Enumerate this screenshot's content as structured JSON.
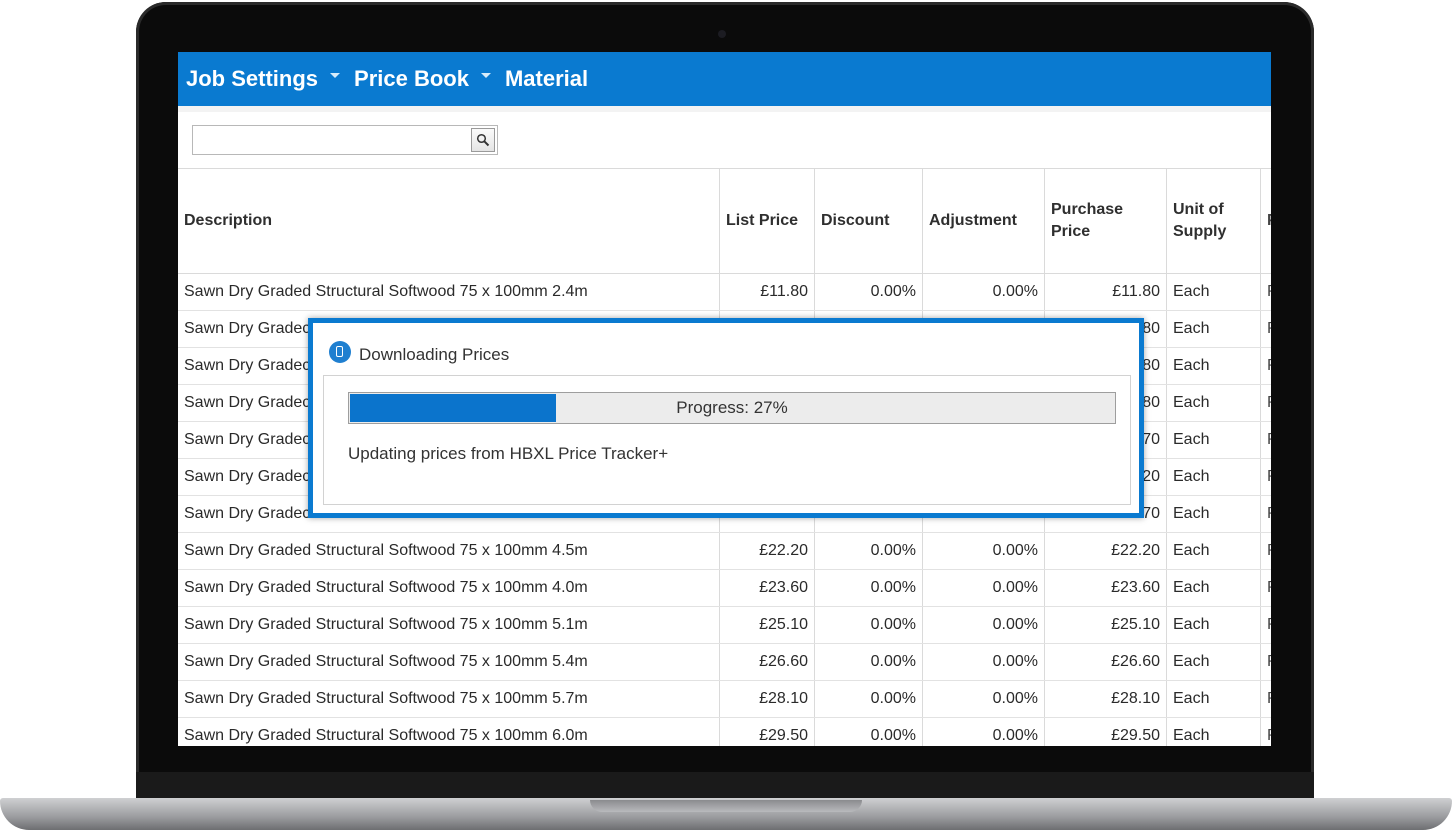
{
  "nav": {
    "items": [
      {
        "label": "Job Settings",
        "dropdown": true
      },
      {
        "label": "Price Book",
        "dropdown": true
      },
      {
        "label": "Material",
        "dropdown": false
      }
    ]
  },
  "search": {
    "value": "",
    "placeholder": "",
    "icon": "search-icon"
  },
  "table": {
    "headers": {
      "description": "Description",
      "list_price": "List Price",
      "discount": "Discount",
      "adjustment": "Adjustment",
      "purchase_price": "Purchase Price",
      "unit_of_supply": "Unit of Supply",
      "truncated": "P"
    },
    "rows": [
      {
        "description": "Sawn Dry Graded Structural Softwood 75 x 100mm 2.4m",
        "list_price": "£11.80",
        "discount": "0.00%",
        "adjustment": "0.00%",
        "purchase_price": "£11.80",
        "unit": "Each",
        "truncated": "P"
      },
      {
        "description": "Sawn Dry Gradec",
        "list_price": "",
        "discount": "",
        "adjustment": "",
        "purchase_price": "80",
        "unit": "Each",
        "truncated": "P"
      },
      {
        "description": "Sawn Dry Gradec",
        "list_price": "",
        "discount": "",
        "adjustment": "",
        "purchase_price": "80",
        "unit": "Each",
        "truncated": "P"
      },
      {
        "description": "Sawn Dry Gradec",
        "list_price": "",
        "discount": "",
        "adjustment": "",
        "purchase_price": "80",
        "unit": "Each",
        "truncated": "P"
      },
      {
        "description": "Sawn Dry Gradec",
        "list_price": "",
        "discount": "",
        "adjustment": "",
        "purchase_price": "70",
        "unit": "Each",
        "truncated": "P"
      },
      {
        "description": "Sawn Dry Gradec",
        "list_price": "",
        "discount": "",
        "adjustment": "",
        "purchase_price": "20",
        "unit": "Each",
        "truncated": "P"
      },
      {
        "description": "Sawn Dry Gradec",
        "list_price": "",
        "discount": "",
        "adjustment": "",
        "purchase_price": "70",
        "unit": "Each",
        "truncated": "P"
      },
      {
        "description": "Sawn Dry Graded Structural Softwood 75 x 100mm 4.5m",
        "list_price": "£22.20",
        "discount": "0.00%",
        "adjustment": "0.00%",
        "purchase_price": "£22.20",
        "unit": "Each",
        "truncated": "P"
      },
      {
        "description": "Sawn Dry Graded Structural Softwood 75 x 100mm 4.0m",
        "list_price": "£23.60",
        "discount": "0.00%",
        "adjustment": "0.00%",
        "purchase_price": "£23.60",
        "unit": "Each",
        "truncated": "P"
      },
      {
        "description": "Sawn Dry Graded Structural Softwood 75 x 100mm 5.1m",
        "list_price": "£25.10",
        "discount": "0.00%",
        "adjustment": "0.00%",
        "purchase_price": "£25.10",
        "unit": "Each",
        "truncated": "P"
      },
      {
        "description": "Sawn Dry Graded Structural Softwood 75 x 100mm 5.4m",
        "list_price": "£26.60",
        "discount": "0.00%",
        "adjustment": "0.00%",
        "purchase_price": "£26.60",
        "unit": "Each",
        "truncated": "P"
      },
      {
        "description": "Sawn Dry Graded Structural Softwood 75 x 100mm 5.7m",
        "list_price": "£28.10",
        "discount": "0.00%",
        "adjustment": "0.00%",
        "purchase_price": "£28.10",
        "unit": "Each",
        "truncated": "P"
      },
      {
        "description": "Sawn Dry Graded Structural Softwood 75 x 100mm 6.0m",
        "list_price": "£29.50",
        "discount": "0.00%",
        "adjustment": "0.00%",
        "purchase_price": "£29.50",
        "unit": "Each",
        "truncated": "P"
      }
    ]
  },
  "dialog": {
    "title": "Downloading Prices",
    "icon": "download-info-icon",
    "progress_percent": 27,
    "progress_label": "Progress: 27%",
    "status": "Updating prices from HBXL Price Tracker+"
  },
  "colors": {
    "accent": "#0a7ad0",
    "progress_fill": "#0b74cc",
    "bezel": "#0b0b0b"
  }
}
